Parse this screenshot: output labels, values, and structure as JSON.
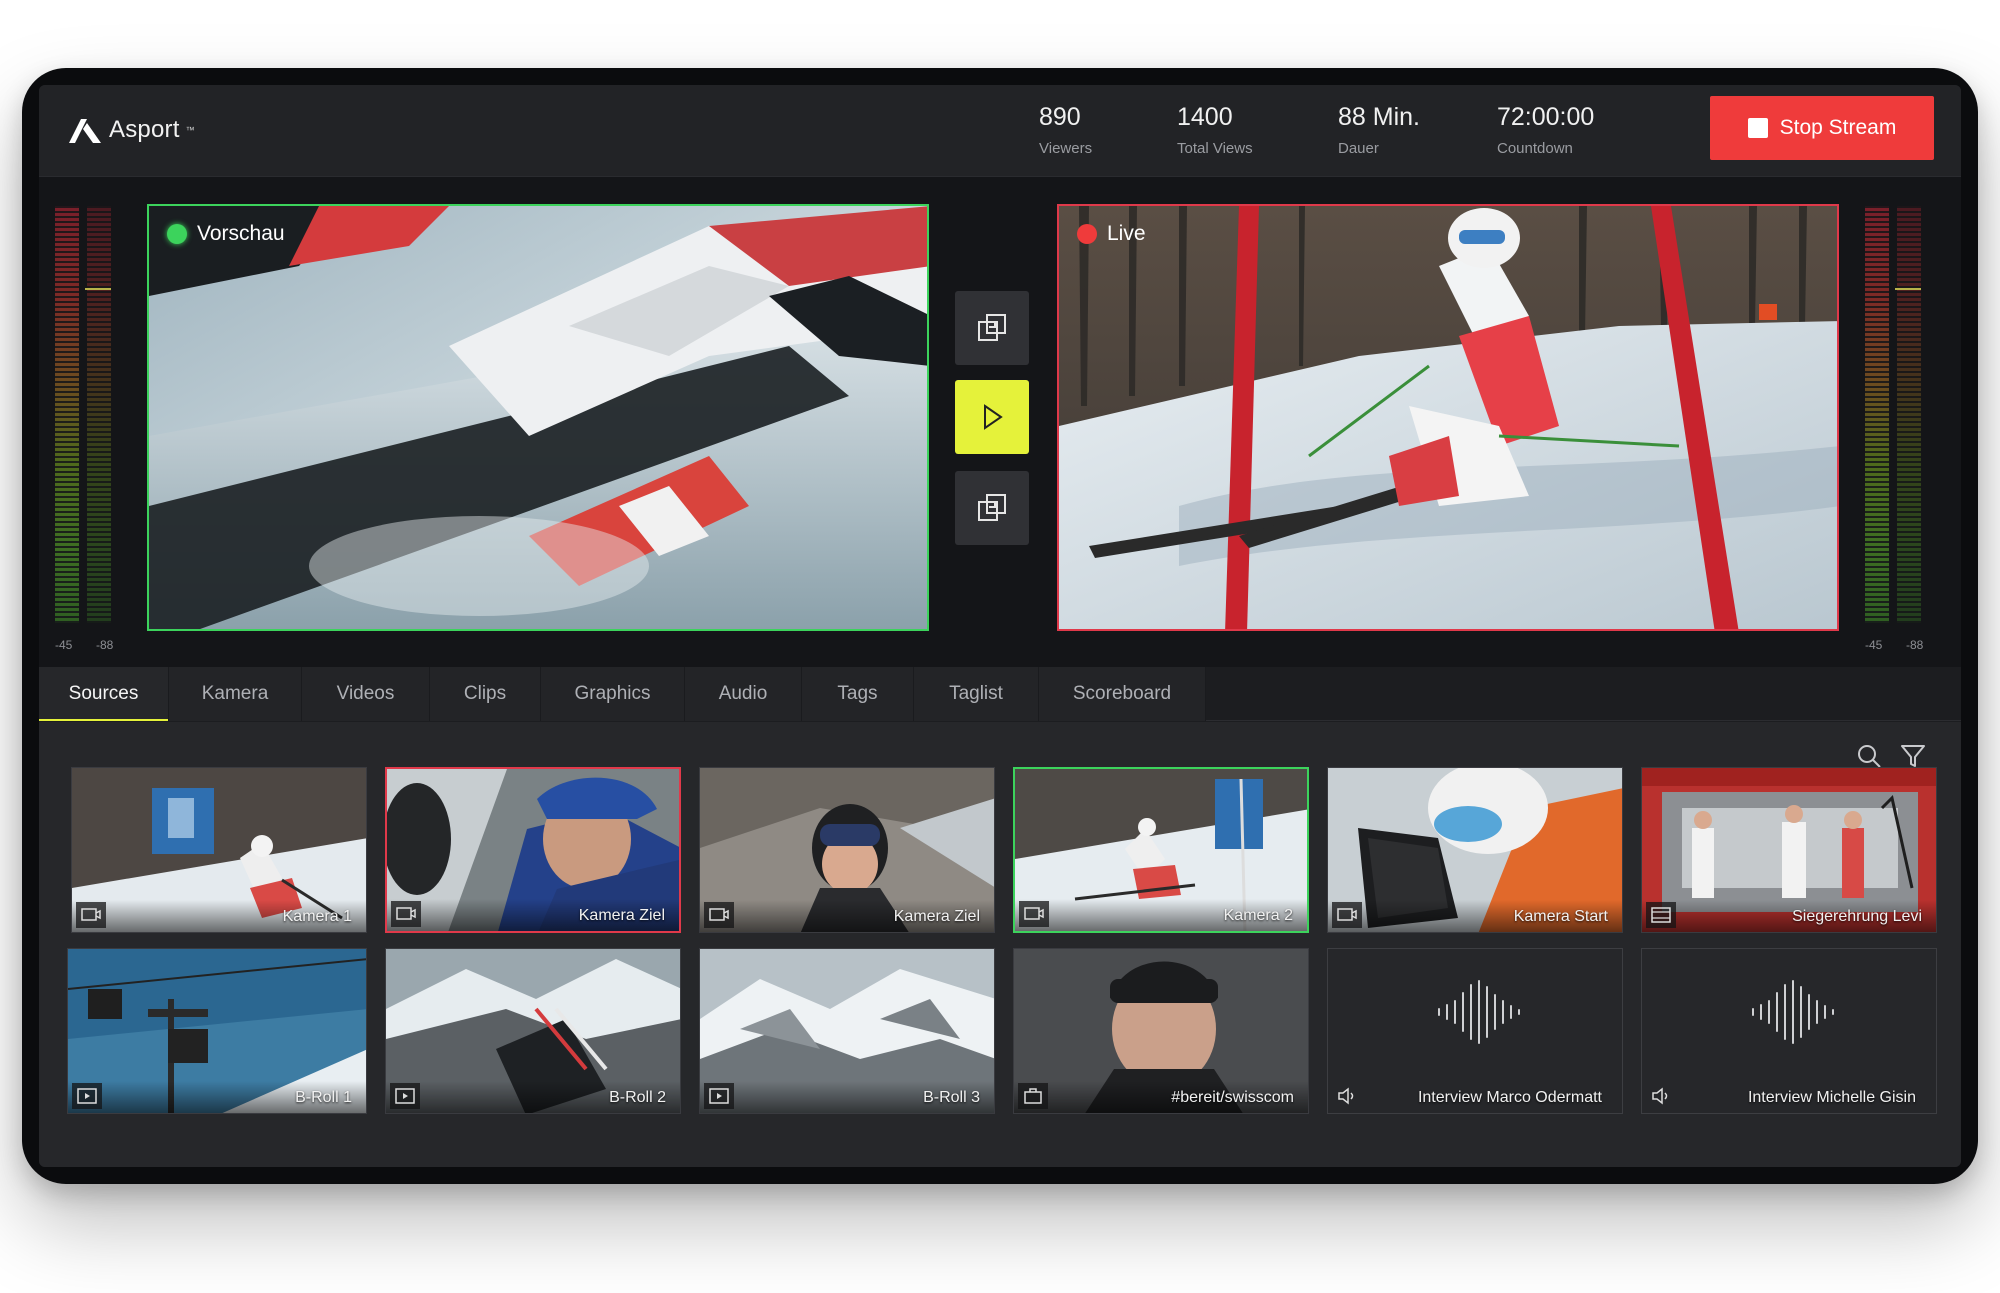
{
  "app": {
    "name": "Asport",
    "trademark": "™"
  },
  "header": {
    "stats": [
      {
        "value": "890",
        "label": "Viewers"
      },
      {
        "value": "1400",
        "label": "Total Views"
      },
      {
        "value": "88 Min.",
        "label": "Dauer"
      },
      {
        "value": "72:00:00",
        "label": "Countdown"
      }
    ],
    "stop_label": "Stop Stream"
  },
  "monitors": {
    "preview_label": "Vorschau",
    "live_label": "Live",
    "meter_left": {
      "low": "-45",
      "high": "-88"
    },
    "meter_right": {
      "low": "-45",
      "high": "-88"
    }
  },
  "tabs": [
    "Sources",
    "Kamera",
    "Videos",
    "Clips",
    "Graphics",
    "Audio",
    "Tags",
    "Taglist",
    "Scoreboard"
  ],
  "active_tab": "Sources",
  "sources": {
    "row1": [
      {
        "label": "Kamera 1",
        "icon": "camera-icon",
        "state": "none"
      },
      {
        "label": "Kamera Ziel",
        "icon": "camera-icon",
        "state": "live"
      },
      {
        "label": "Kamera Ziel",
        "icon": "camera-icon",
        "state": "none"
      },
      {
        "label": "Kamera 2",
        "icon": "camera-icon",
        "state": "preview"
      },
      {
        "label": "Kamera Start",
        "icon": "camera-icon",
        "state": "none"
      },
      {
        "label": "Siegerehrung Levi",
        "icon": "film-icon",
        "state": "none"
      }
    ],
    "row2": [
      {
        "label": "B-Roll 1",
        "icon": "video-icon",
        "state": "none"
      },
      {
        "label": "B-Roll 2",
        "icon": "video-icon",
        "state": "none"
      },
      {
        "label": "B-Roll 3",
        "icon": "video-icon",
        "state": "none"
      },
      {
        "label": "#bereit/swisscom",
        "icon": "image-icon",
        "state": "none"
      },
      {
        "label": "Interview Marco Odermatt",
        "icon": "speaker-icon",
        "state": "none"
      },
      {
        "label": "Interview Michelle Gisin",
        "icon": "speaker-icon",
        "state": "none"
      }
    ]
  },
  "colors": {
    "accent": "#e5f23a",
    "live": "#e0394a",
    "preview": "#3cd35c",
    "stop": "#ef3b3b"
  }
}
